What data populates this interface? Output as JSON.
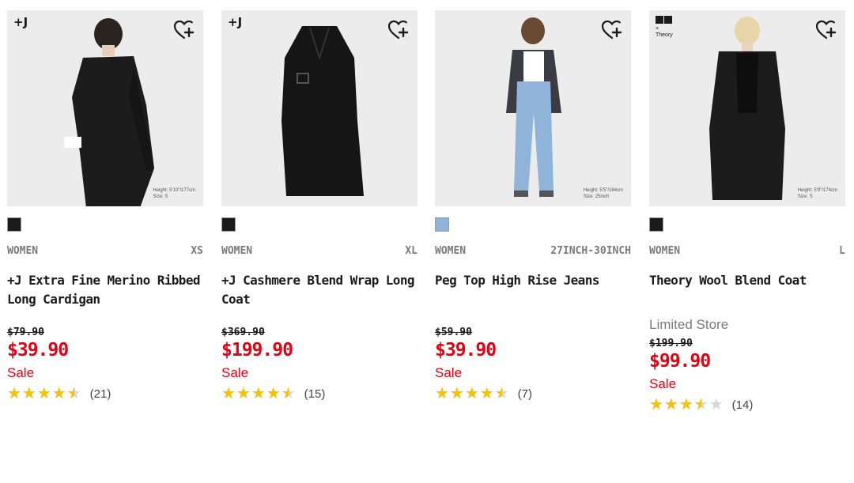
{
  "colors": {
    "sale": "#e60012",
    "star": "#f6c300",
    "tile_bg": "#ececec"
  },
  "favorite_icon": "heart-plus-icon",
  "products": [
    {
      "badge": "+J",
      "height_note": [
        "Height: 5'10\"/177cm",
        "Size: S"
      ],
      "swatch": "#1b1b1b",
      "category": "WOMEN",
      "size": "XS",
      "name": "+J Extra Fine Merino Ribbed Long Cardigan",
      "store": "",
      "was_price": "$79.90",
      "price": "$39.90",
      "flag": "Sale",
      "rating": 4.5,
      "reviews": "(21)"
    },
    {
      "badge": "+J",
      "height_note": [
        "",
        ""
      ],
      "swatch": "#1b1b1b",
      "category": "WOMEN",
      "size": "XL",
      "name": "+J Cashmere Blend Wrap Long Coat",
      "store": "",
      "was_price": "$369.90",
      "price": "$199.90",
      "flag": "Sale",
      "rating": 4.5,
      "reviews": "(15)"
    },
    {
      "badge": "",
      "height_note": [
        "Height: 5'5\"/164cm",
        "Size: 25inch"
      ],
      "swatch": "#8fb3d9",
      "category": "WOMEN",
      "size": "27INCH-30INCH",
      "name": "Peg Top High Rise Jeans",
      "store": "",
      "was_price": "$59.90",
      "price": "$39.90",
      "flag": "Sale",
      "rating": 4.5,
      "reviews": "(7)"
    },
    {
      "badge": "Theory",
      "height_note": [
        "Height: 5'9\"/174cm",
        "Size: S"
      ],
      "swatch": "#1b1b1b",
      "category": "WOMEN",
      "size": "L",
      "name": "Theory Wool Blend Coat",
      "store": "Limited Store",
      "was_price": "$199.90",
      "price": "$99.90",
      "flag": "Sale",
      "rating": 3.5,
      "reviews": "(14)"
    }
  ]
}
